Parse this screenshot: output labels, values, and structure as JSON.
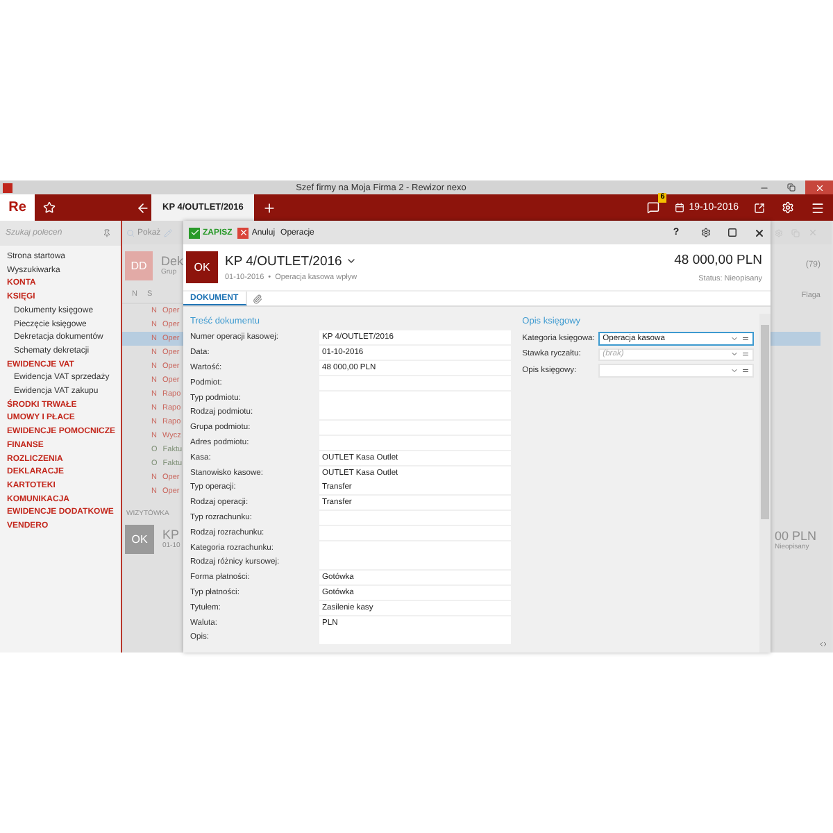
{
  "window": {
    "title": "Szef firmy na Moja Firma 2 - Rewizor nexo"
  },
  "app_bar": {
    "logo": "Re",
    "tabs": [
      {
        "label": "KP 4/OUTLET/2016",
        "selected": true
      }
    ],
    "notifications": "6",
    "date": "19-10-2016"
  },
  "sidebar": {
    "search": {
      "placeholder": "Szukaj poleceń"
    },
    "items": [
      {
        "label": "Strona startowa",
        "kind": "link"
      },
      {
        "label": "Wyszukiwarka",
        "kind": "link"
      },
      {
        "label": "KONTA",
        "kind": "section"
      },
      {
        "label": "KSIĘGI",
        "kind": "section",
        "children": [
          {
            "label": "Dokumenty księgowe",
            "kind": "link"
          },
          {
            "label": "Pieczęcie księgowe",
            "kind": "link"
          },
          {
            "label": "Dekretacja dokumentów",
            "kind": "link"
          },
          {
            "label": "Schematy dekretacji",
            "kind": "link"
          }
        ]
      },
      {
        "label": "EWIDENCJE VAT",
        "kind": "section",
        "children": [
          {
            "label": "Ewidencja VAT sprzedaży",
            "kind": "link"
          },
          {
            "label": "Ewidencja VAT zakupu",
            "kind": "link"
          }
        ]
      },
      {
        "label": "ŚRODKI TRWAŁE",
        "kind": "section"
      },
      {
        "label": "UMOWY I PŁACE",
        "kind": "section"
      },
      {
        "label": "EWIDENCJE POMOCNICZE",
        "kind": "section"
      },
      {
        "label": "FINANSE",
        "kind": "section"
      },
      {
        "label": "ROZLICZENIA",
        "kind": "section"
      },
      {
        "label": "DEKLARACJE",
        "kind": "section"
      },
      {
        "label": "KARTOTEKI",
        "kind": "section"
      },
      {
        "label": "KOMUNIKACJA",
        "kind": "section"
      },
      {
        "label": "EWIDENCJE DODATKOWE",
        "kind": "section"
      },
      {
        "label": "VENDERO",
        "kind": "section"
      }
    ]
  },
  "background_list": {
    "toolbar": "Pokaż",
    "card": {
      "badge": "DD",
      "title": "Dek",
      "subtitle": "Grup"
    },
    "columns": [
      "N",
      "S"
    ],
    "rows": [
      {
        "status": "N",
        "name": "Oper",
        "selected": false,
        "color": "#c9655c"
      },
      {
        "status": "N",
        "name": "Oper",
        "selected": false,
        "color": "#c9655c"
      },
      {
        "status": "N",
        "name": "Oper",
        "selected": true,
        "color": "#c9655c"
      },
      {
        "status": "N",
        "name": "Oper",
        "selected": false,
        "color": "#c9655c"
      },
      {
        "status": "N",
        "name": "Oper",
        "selected": false,
        "color": "#c9655c"
      },
      {
        "status": "N",
        "name": "Oper",
        "selected": false,
        "color": "#c9655c"
      },
      {
        "status": "N",
        "name": "Rapo",
        "selected": false,
        "color": "#c9655c"
      },
      {
        "status": "N",
        "name": "Rapo",
        "selected": false,
        "color": "#c9655c"
      },
      {
        "status": "N",
        "name": "Rapo",
        "selected": false,
        "color": "#c9655c"
      },
      {
        "status": "N",
        "name": "Wycz",
        "selected": false,
        "color": "#c9655c"
      },
      {
        "status": "O",
        "name": "Faktu",
        "selected": false,
        "color": "#7f9077"
      },
      {
        "status": "O",
        "name": "Faktu",
        "selected": false,
        "color": "#7f9077"
      },
      {
        "status": "N",
        "name": "Oper",
        "selected": false,
        "color": "#c9655c"
      },
      {
        "status": "N",
        "name": "Oper",
        "selected": false,
        "color": "#c9655c"
      }
    ],
    "section": "WIZYTÓWKA",
    "footer_card": {
      "badge": "OK",
      "title": "KP",
      "subtitle": "01-10"
    },
    "right": {
      "count": "(79)",
      "column": "Flaga",
      "amount": "00 PLN",
      "status": "Nieopisany"
    }
  },
  "dialog": {
    "toolbar": {
      "save": "ZAPISZ",
      "cancel": "Anuluj",
      "operations": "Operacje",
      "help": "?"
    },
    "header": {
      "badge": "OK",
      "number": "KP 4/OUTLET/2016",
      "date": "01-10-2016",
      "separator": "•",
      "type": "Operacja kasowa wpływ",
      "amount": "48 000,00 PLN",
      "status": "Status: Nieopisany"
    },
    "tabs": [
      {
        "label": "DOKUMENT",
        "selected": true
      }
    ],
    "content": {
      "title": "Treść dokumentu",
      "fields": [
        {
          "label": "Numer operacji kasowej:",
          "value": "KP 4/OUTLET/2016"
        },
        {
          "label": "Data:",
          "value": "01-10-2016"
        },
        {
          "label": "Wartość:",
          "value": "48 000,00 PLN"
        },
        {
          "label": "Podmiot:"
        },
        {
          "label": "Typ podmiotu:"
        },
        {
          "label": "Rodzaj podmiotu:"
        },
        {
          "label": "Grupa podmiotu:"
        },
        {
          "label": "Adres podmiotu:"
        },
        {
          "label": "Kasa:",
          "value": "OUTLET Kasa Outlet"
        },
        {
          "label": "Stanowisko kasowe:",
          "value": "OUTLET Kasa Outlet"
        },
        {
          "label": "Typ operacji:",
          "value": "Transfer"
        },
        {
          "label": "Rodzaj operacji:",
          "value": "Transfer"
        },
        {
          "label": "Typ rozrachunku:"
        },
        {
          "label": "Rodzaj rozrachunku:"
        },
        {
          "label": "Kategoria rozrachunku:"
        },
        {
          "label": "Rodzaj różnicy kursowej:"
        },
        {
          "label": "Forma płatności:",
          "value": "Gotówka"
        },
        {
          "label": "Typ płatności:",
          "value": "Gotówka"
        },
        {
          "label": "Tytułem:",
          "value": "Zasilenie kasy"
        },
        {
          "label": "Waluta:",
          "value": "PLN"
        },
        {
          "label": "Opis:"
        }
      ]
    },
    "accounting": {
      "title": "Opis księgowy",
      "fields": [
        {
          "label": "Kategoria księgowa:",
          "value": "Operacja kasowa",
          "focused": true
        },
        {
          "label": "Stawka ryczałtu:",
          "placeholder": "(brak)",
          "focused": false
        },
        {
          "label": "Opis księgowy:",
          "focused": false
        }
      ]
    }
  }
}
